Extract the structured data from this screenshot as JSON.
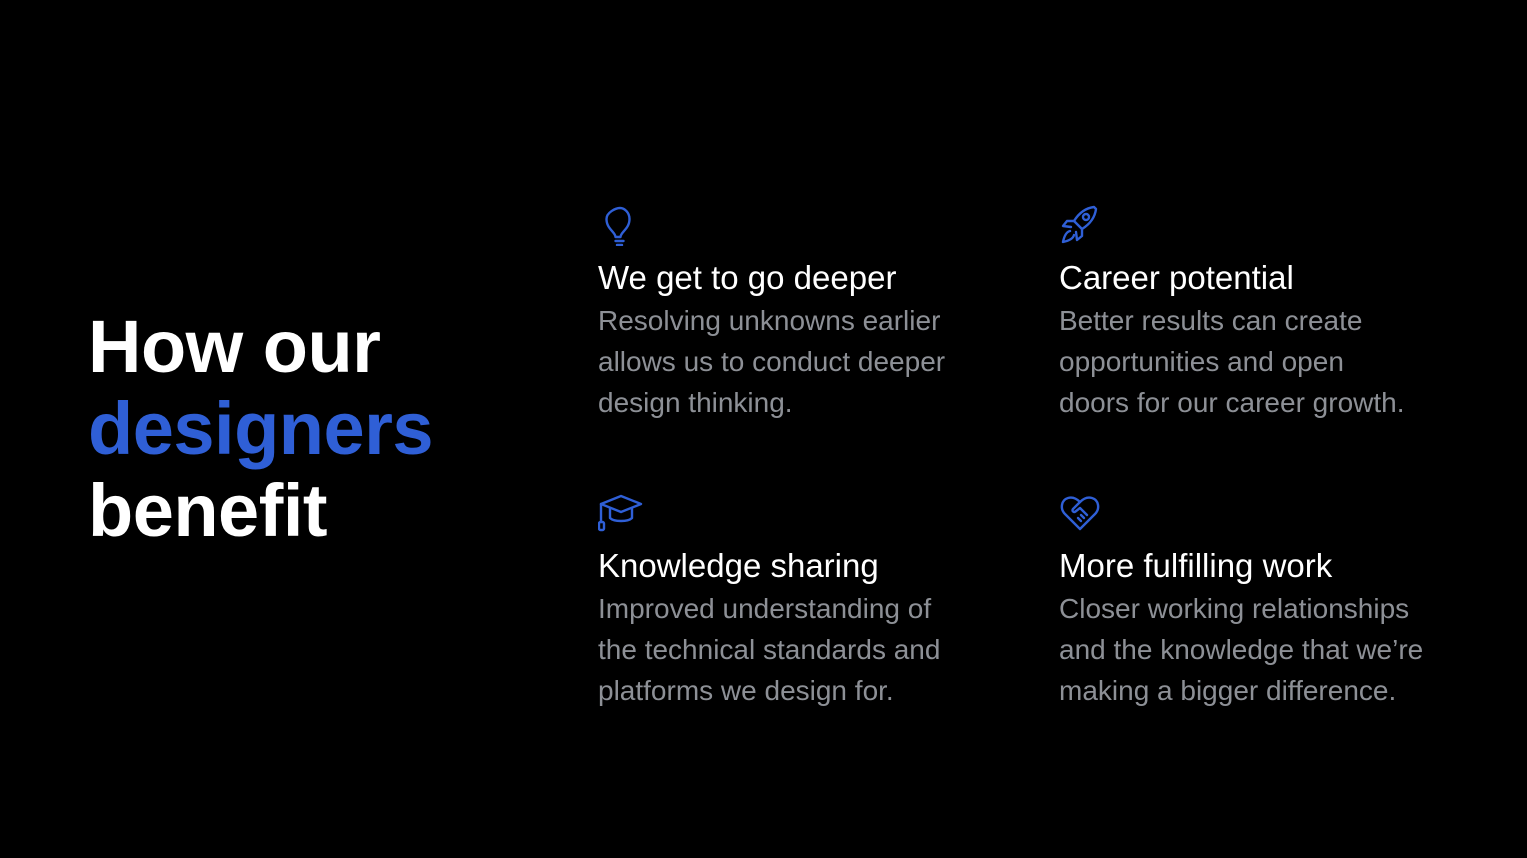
{
  "headline": {
    "line1": "How our",
    "line2": "designers",
    "line3": "benefit"
  },
  "colors": {
    "background": "#000000",
    "accent": "#2f5fd6",
    "title": "#ffffff",
    "body": "#8d9096"
  },
  "benefits": [
    {
      "icon": "lightbulb-icon",
      "title": "We get to go deeper",
      "description_lines": [
        "Resolving unknowns earlier",
        "allows us to conduct deeper",
        "design thinking."
      ]
    },
    {
      "icon": "rocket-icon",
      "title": "Career potential",
      "description_lines": [
        "Better results can create",
        "opportunities and open",
        "doors for our career growth."
      ]
    },
    {
      "icon": "graduation-cap-icon",
      "title": "Knowledge sharing",
      "description_lines": [
        "Improved understanding of",
        "the technical standards and",
        "platforms we design for."
      ]
    },
    {
      "icon": "heart-handshake-icon",
      "title": "More fulfilling work",
      "description_lines": [
        "Closer working relationships",
        "and the knowledge that we’re",
        "making a bigger difference."
      ]
    }
  ]
}
